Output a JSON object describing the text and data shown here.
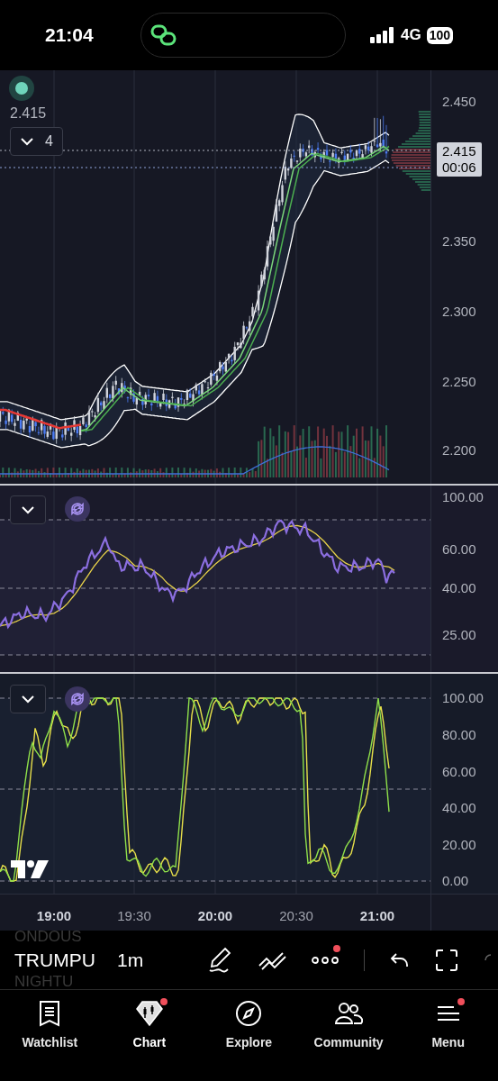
{
  "status_bar": {
    "time": "21:04",
    "network": "4G",
    "battery": "100"
  },
  "main_chart": {
    "last_price": "2.415",
    "indicator_count": "4",
    "axis_labels": [
      "2.450",
      "2.350",
      "2.300",
      "2.250",
      "2.200"
    ],
    "price_tag": {
      "price": "2.415",
      "countdown": "00:06"
    }
  },
  "rsi_panel": {
    "axis_labels": [
      "100.00",
      "60.00",
      "40.00",
      "25.00"
    ]
  },
  "stoch_panel": {
    "axis_labels": [
      "100.00",
      "80.00",
      "60.00",
      "40.00",
      "20.00",
      "0.00"
    ]
  },
  "time_axis": [
    {
      "label": "19:00",
      "major": true
    },
    {
      "label": "19:30",
      "major": false
    },
    {
      "label": "20:00",
      "major": true
    },
    {
      "label": "20:30",
      "major": false
    },
    {
      "label": "21:00",
      "major": true
    }
  ],
  "toolbar": {
    "symbol_above": "ONDOUS",
    "symbol": "TRUMPU",
    "symbol_below": "NIGHTU",
    "interval": "1m",
    "more_badge": true
  },
  "nav": [
    {
      "label": "Watchlist",
      "kind": "watchlist",
      "selected": false,
      "badge": false
    },
    {
      "label": "Chart",
      "kind": "chart",
      "selected": true,
      "badge": true
    },
    {
      "label": "Explore",
      "kind": "explore",
      "selected": false,
      "badge": false
    },
    {
      "label": "Community",
      "kind": "community",
      "selected": false,
      "badge": false
    },
    {
      "label": "Menu",
      "kind": "menu",
      "selected": false,
      "badge": true
    }
  ]
}
